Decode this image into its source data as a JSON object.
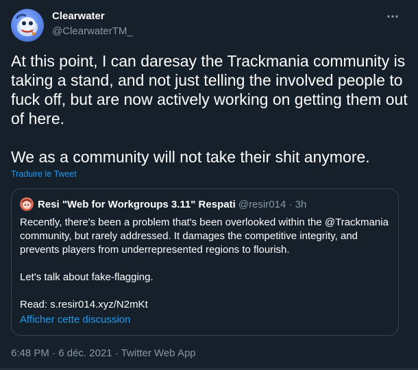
{
  "author": {
    "display_name": "Clearwater",
    "handle": "@ClearwaterTM_"
  },
  "more_icon": "more-horizontal-icon",
  "tweet": {
    "text": "At this point, I can daresay the Trackmania community is taking a stand, and not just telling the involved people to fuck off, but are now actively working on getting them out of here.\n\nWe as a community will not take their shit anymore.",
    "translate_label": "Traduire le Tweet"
  },
  "quoted": {
    "display_name": "Resi \"Web for Workgroups 3.11\" Respati",
    "handle": "@resir014",
    "separator": "·",
    "time": "3h",
    "text": "Recently, there's been a problem that's been overlooked within the @Trackmania community, but rarely addressed. It damages the competitive integrity, and prevents players from underrepresented regions to flourish.\n\nLet's talk about fake-flagging.\n\nRead: s.resir014.xyz/N2mKt",
    "show_thread_label": "Afficher cette discussion"
  },
  "meta": {
    "time": "6:48 PM",
    "separator": "·",
    "date": "6 déc. 2021",
    "separator2": "·",
    "app": "Twitter Web App"
  },
  "colors": {
    "background": "#15202b",
    "text": "#ffffff",
    "secondary": "#8899a6",
    "link": "#1d9bf0",
    "border": "#38444d"
  }
}
